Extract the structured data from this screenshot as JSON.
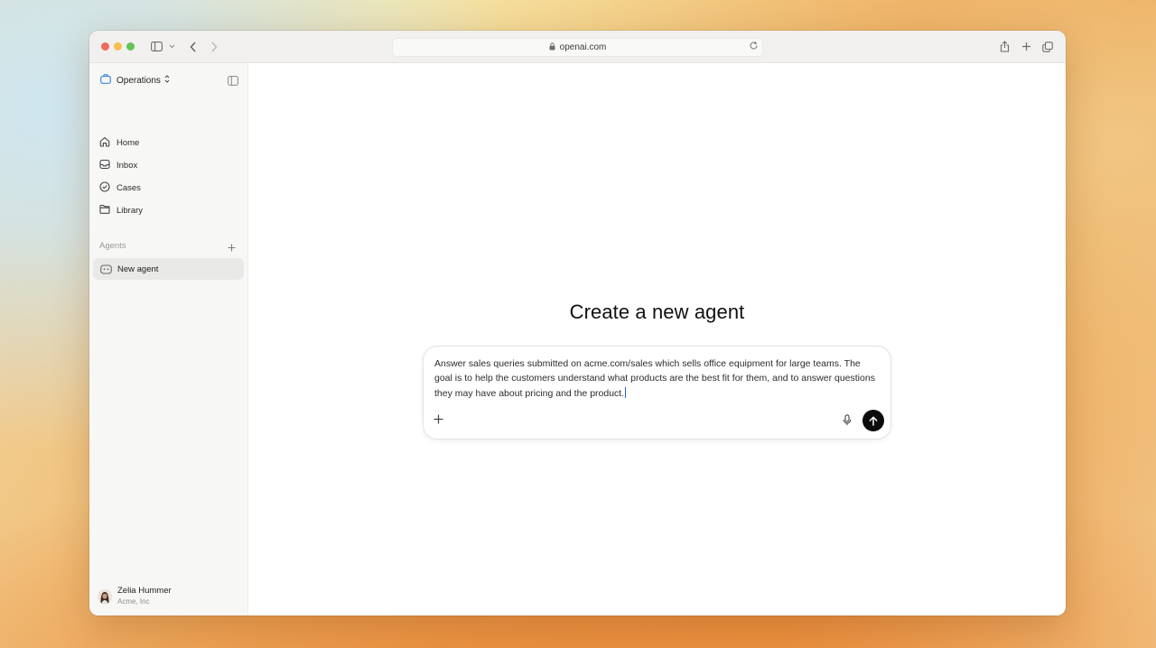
{
  "browser": {
    "url": "openai.com"
  },
  "sidebar": {
    "workspace": "Operations",
    "nav": [
      {
        "label": "Home",
        "icon": "home-icon"
      },
      {
        "label": "Inbox",
        "icon": "inbox-icon"
      },
      {
        "label": "Cases",
        "icon": "check-circle-icon"
      },
      {
        "label": "Library",
        "icon": "folder-icon"
      }
    ],
    "agents_label": "Agents",
    "agents": [
      {
        "label": "New agent",
        "icon": "bot-icon"
      }
    ],
    "user": {
      "name": "Zelia Hummer",
      "org": "Acme, Inc"
    }
  },
  "main": {
    "heading": "Create a new agent",
    "composer": {
      "value": "Answer sales queries submitted on acme.com/sales which sells office equipment for large teams. The goal is to help the customers understand what products are the best fit for them, and to answer questions they may have about pricing and the product."
    }
  },
  "colors": {
    "workspace_accent": "#3d8ae0",
    "send_button": "#0b0b0b",
    "caret": "#2b5cd9"
  }
}
